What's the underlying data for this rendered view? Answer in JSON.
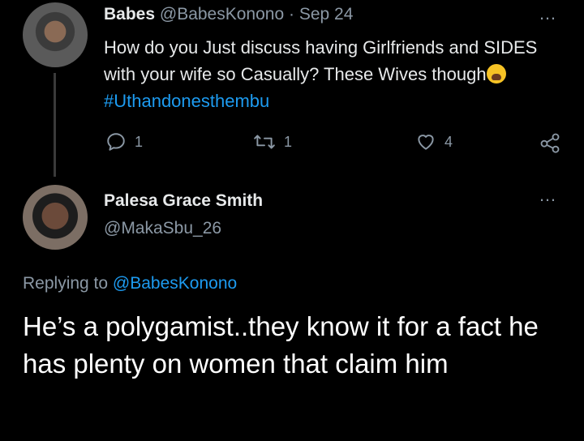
{
  "tweet": {
    "name": "Babes",
    "handle": "@BabesKonono",
    "separator": "·",
    "date": "Sep 24",
    "text_before": "How do you Just discuss having Girlfriends and SIDES with your wife so Casually? These Wives though",
    "hashtag": "#Uthandonesthembu",
    "emoji": "crying-face",
    "replies": "1",
    "retweets": "1",
    "likes": "4",
    "more_icon": "…"
  },
  "reply": {
    "name": "Palesa Grace Smith",
    "handle": "@MakaSbu_26",
    "more_icon": "…",
    "replying_prefix": "Replying to",
    "replying_handle": "@BabesKonono",
    "text": "He’s a polygamist..they know it for a fact he has plenty on women that claim him"
  },
  "colors": {
    "background": "#000000",
    "link": "#1d9bf0",
    "muted": "#8b98a5"
  }
}
